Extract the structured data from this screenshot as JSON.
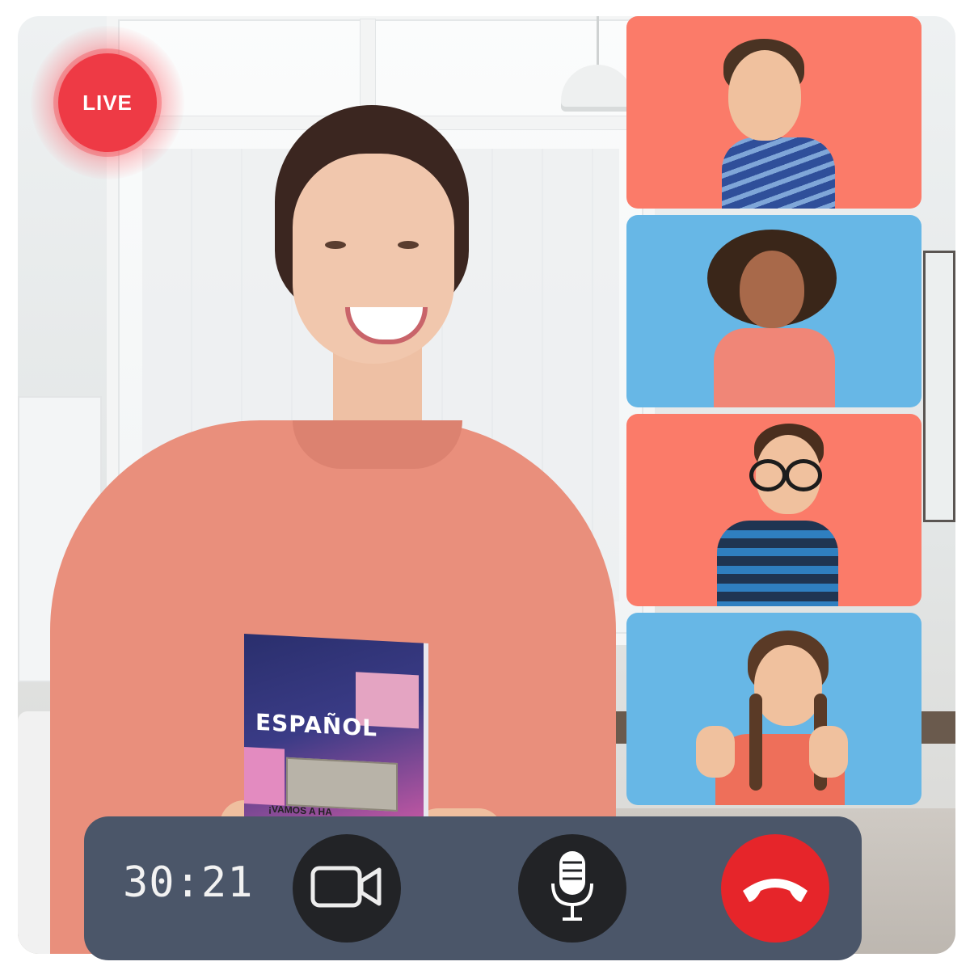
{
  "stream": {
    "live_label": "LIVE"
  },
  "book": {
    "title": "ESPAÑOL",
    "subtitle": "¡VAMOS A HA"
  },
  "participants": [
    {
      "name": "participant-boy-striped-shirt",
      "tile_color": "#fb7b69"
    },
    {
      "name": "participant-girl-curly-hair",
      "tile_color": "#67b7e6"
    },
    {
      "name": "participant-boy-glasses",
      "tile_color": "#fb7b69"
    },
    {
      "name": "participant-girl-braids-thumbs-up",
      "tile_color": "#67b7e6"
    }
  ],
  "controls": {
    "timer": "30:21",
    "video_icon": "video-camera-icon",
    "mic_icon": "microphone-icon",
    "end_icon": "hang-up-phone-icon",
    "end_color": "#e6252a",
    "bar_color": "#4b5669"
  }
}
